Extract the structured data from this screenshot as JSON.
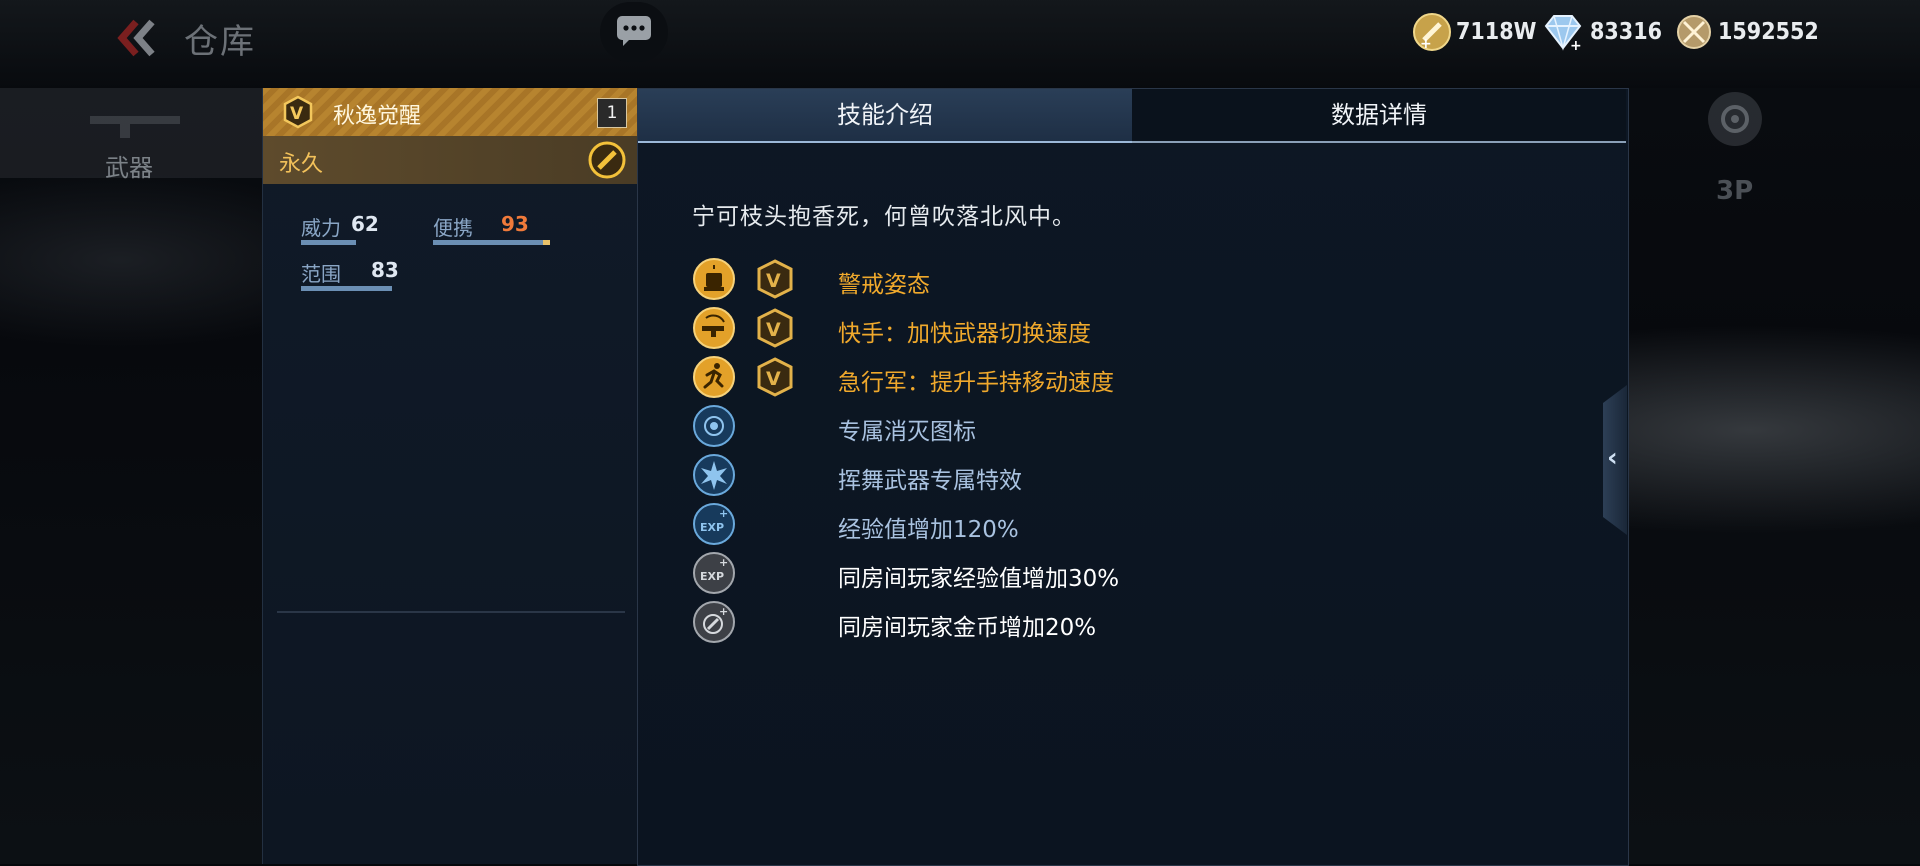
{
  "header": {
    "title": "仓库",
    "back_icon": "double-chevron-left-icon",
    "chat_icon": "chat-bubble-icon"
  },
  "currencies": [
    {
      "name": "gold",
      "value": "7118W",
      "icon": "gold-coin-plus-icon"
    },
    {
      "name": "diamond",
      "value": "83316",
      "icon": "diamond-plus-icon"
    },
    {
      "name": "honor",
      "value": "1592552",
      "icon": "crossed-medal-icon"
    }
  ],
  "sidebar": {
    "weapon_tab_label": "武器"
  },
  "view_mode": {
    "label": "3P"
  },
  "item": {
    "name": "秋逸觉醒",
    "count": "1",
    "duration": "永久",
    "stats": [
      {
        "label": "威力",
        "value": "62",
        "fill": 0.62,
        "color": "#dfe7f1"
      },
      {
        "label": "便携",
        "value": "93",
        "fill": 0.93,
        "color": "#f07a3a"
      },
      {
        "label": "范围",
        "value": "83",
        "fill": 0.83,
        "color": "#dfe7f1"
      }
    ]
  },
  "tabs": [
    {
      "label": "技能介绍",
      "active": true
    },
    {
      "label": "数据详情",
      "active": false
    }
  ],
  "skills_panel": {
    "quote": "宁可枝头抱香死，何曾吹落北风中。",
    "skills": [
      {
        "text": "警戒姿态",
        "icon": "alert-siren-icon",
        "vip": true,
        "tier": "gold"
      },
      {
        "text": "快手：加快武器切换速度",
        "icon": "quick-switch-gun-icon",
        "vip": true,
        "tier": "gold"
      },
      {
        "text": "急行军：提升手持移动速度",
        "icon": "running-man-icon",
        "vip": true,
        "tier": "gold"
      },
      {
        "text": "专属消灭图标",
        "icon": "kill-mark-icon",
        "vip": false,
        "tier": "blue"
      },
      {
        "text": "挥舞武器专属特效",
        "icon": "burst-effect-icon",
        "vip": false,
        "tier": "blue"
      },
      {
        "text": "经验值增加120%",
        "icon": "exp-plus-icon",
        "vip": false,
        "tier": "blue"
      },
      {
        "text": "同房间玩家经验值增加30%",
        "icon": "exp-room-icon",
        "vip": false,
        "tier": "silver"
      },
      {
        "text": "同房间玩家金币增加20%",
        "icon": "coin-room-icon",
        "vip": false,
        "tier": "silver"
      }
    ]
  },
  "colors": {
    "gold_text": "#f0a92c",
    "blue_text": "#a9c2e0",
    "white_text": "#ffffff"
  }
}
